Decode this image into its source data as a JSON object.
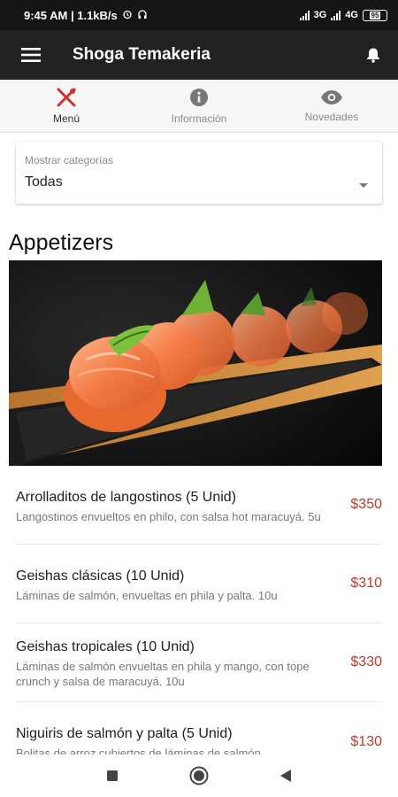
{
  "status_bar": {
    "time_info": "9:45 AM | 1.1kB/s",
    "network_1": "3G",
    "network_2": "4G",
    "battery": "95"
  },
  "app_bar": {
    "title": "Shoga Temakeria",
    "menu_icon": "hamburger-menu-icon",
    "notification_icon": "bell-icon"
  },
  "tabs": [
    {
      "label": "Menú",
      "icon": "fork-knife-icon",
      "active": true
    },
    {
      "label": "Información",
      "icon": "info-icon",
      "active": false
    },
    {
      "label": "Novedades",
      "icon": "eye-icon",
      "active": false
    }
  ],
  "category_select": {
    "label": "Mostrar categorías",
    "value": "Todas"
  },
  "section": {
    "title": "Appetizers"
  },
  "items": [
    {
      "name": "Arrolladitos de langostinos (5 Unid)",
      "description": "Langostinos envueltos en philo, con salsa hot maracuyá. 5u",
      "price": "$350"
    },
    {
      "name": "Geishas clásicas (10 Unid)",
      "description": "Láminas de salmón, envueltas en phila y palta. 10u",
      "price": "$310"
    },
    {
      "name": "Geishas tropicales (10 Unid)",
      "description": "Láminas de salmón envueltas en phila y mango, con tope crunch y salsa de maracuyá. 10u",
      "price": "$330"
    },
    {
      "name": "Niguiris de salmón y palta (5 Unid)",
      "description": "Bolitas de arroz cubiertos de láminas de salmón",
      "price": "$130"
    }
  ],
  "colors": {
    "appbar": "#212121",
    "accent_red": "#d32f2f",
    "price": "#c0392b"
  },
  "nav_bar": {
    "recents_icon": "square-recents-icon",
    "home_icon": "circle-home-icon",
    "back_icon": "triangle-back-icon"
  }
}
